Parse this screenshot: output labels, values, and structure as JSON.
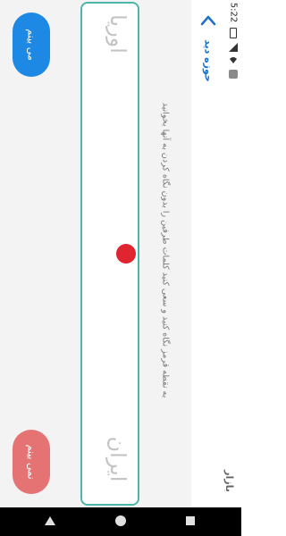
{
  "status_bar": {
    "time": "5:22",
    "icons": [
      "battery-icon",
      "signal-icon",
      "wifi-icon",
      "app-notification-icon"
    ]
  },
  "header": {
    "title": "حوزه دید",
    "back_icon": "chevron-up-icon"
  },
  "instruction": "به نقطه قرمز نگاه کنید و سعی کنید کلمات طرفین را بدون نگاه کردن به آنها بخوانید",
  "exercise": {
    "word_top": "اوریا",
    "word_bottom": "ایران",
    "dot_color": "#e02430",
    "border_color": "#4db6ac"
  },
  "buttons": {
    "see_label": "می بینم",
    "see_color": "#1e88e5",
    "not_see_label": "نمی بینم",
    "not_see_color": "#e57373"
  },
  "navbar": {
    "icons": [
      "back-triangle-icon",
      "home-circle-icon",
      "recents-square-icon"
    ]
  },
  "watermark": "بازار"
}
